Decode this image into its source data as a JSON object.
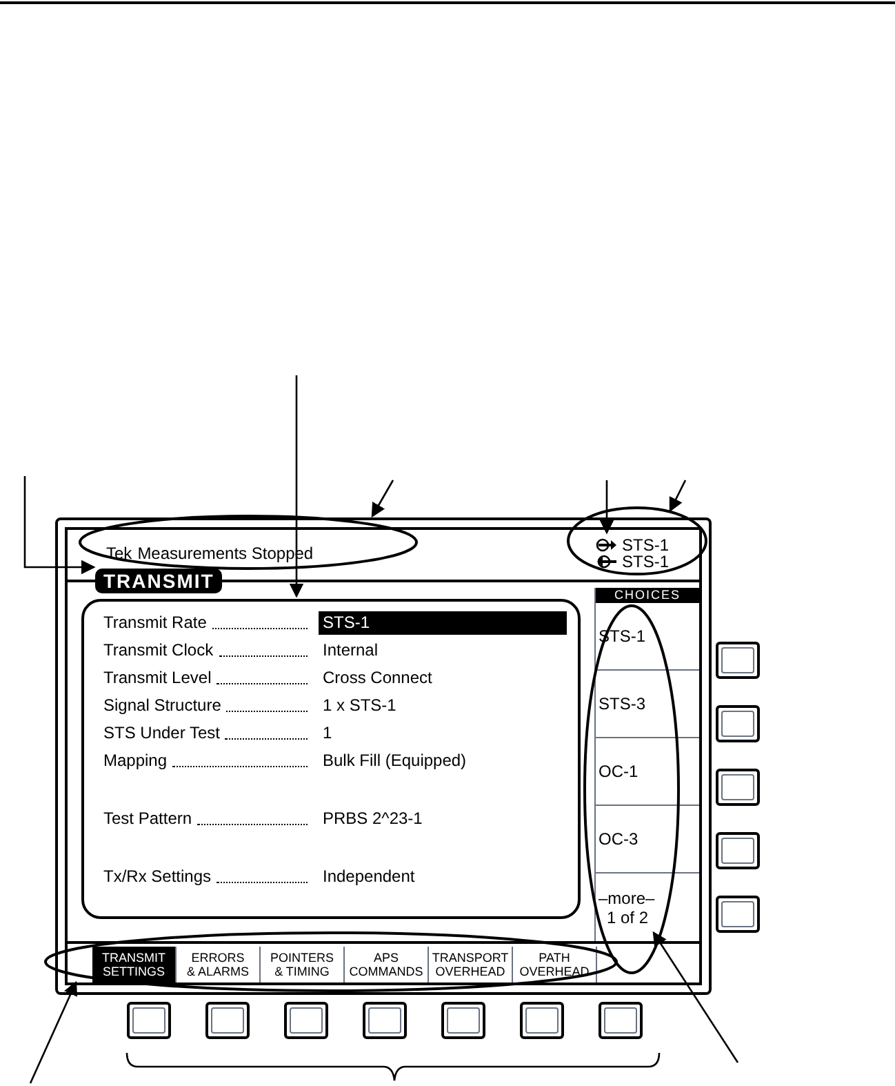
{
  "status_bar": {
    "brand": "Tek",
    "message": "Measurements Stopped"
  },
  "signals": [
    {
      "kind": "transmit",
      "label": "STS-1"
    },
    {
      "kind": "receive",
      "label": "STS-1"
    }
  ],
  "mode_title": "TRANSMIT",
  "settings": [
    {
      "label": "Transmit Rate",
      "value": "STS-1",
      "selected": true
    },
    {
      "label": "Transmit Clock",
      "value": "Internal",
      "selected": false
    },
    {
      "label": "Transmit Level",
      "value": "Cross Connect",
      "selected": false
    },
    {
      "label": "Signal Structure",
      "value": "1 x STS-1",
      "selected": false
    },
    {
      "label": "STS Under Test",
      "value": "1",
      "selected": false
    },
    {
      "label": "Mapping",
      "value": "Bulk Fill (Equipped)",
      "selected": false
    },
    {
      "kind": "gap"
    },
    {
      "label": "Test Pattern",
      "value": "PRBS 2^23-1",
      "selected": false
    },
    {
      "kind": "gap"
    },
    {
      "label": "Tx/Rx Settings",
      "value": "Independent",
      "selected": false
    }
  ],
  "choices": {
    "title": "CHOICES",
    "items": [
      {
        "label": "STS-1"
      },
      {
        "label": "STS-3"
      },
      {
        "label": "OC-1"
      },
      {
        "label": "OC-3"
      },
      {
        "label": "–more–",
        "sublabel": "1 of 2"
      }
    ]
  },
  "tabs": [
    {
      "lines": [
        "TRANSMIT",
        "SETTINGS"
      ],
      "selected": true
    },
    {
      "lines": [
        "ERRORS",
        "& ALARMS"
      ],
      "selected": false
    },
    {
      "lines": [
        "POINTERS",
        "& TIMING"
      ],
      "selected": false
    },
    {
      "lines": [
        "APS",
        "COMMANDS"
      ],
      "selected": false
    },
    {
      "lines": [
        "TRANSPORT",
        "OVERHEAD"
      ],
      "selected": false
    },
    {
      "lines": [
        "PATH",
        "OVERHEAD"
      ],
      "selected": false
    }
  ]
}
